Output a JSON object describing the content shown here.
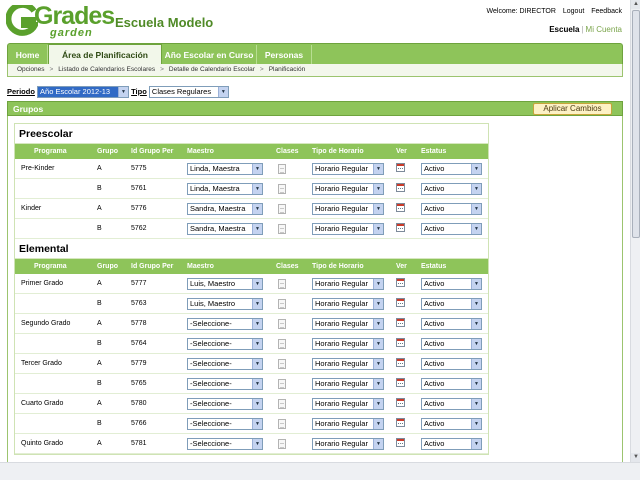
{
  "logo": {
    "line1": "Grades",
    "line2": "garden"
  },
  "school_name": "Escuela Modelo",
  "top_links": {
    "welcome": "Welcome: DIRECTOR",
    "logout": "Logout",
    "feedback": "Feedback"
  },
  "roles": {
    "active": "Escuela",
    "other": "Mi Cuenta"
  },
  "tabs": [
    {
      "label": "Home"
    },
    {
      "label": "Área de Planificación"
    },
    {
      "label": "Año Escolar en Curso"
    },
    {
      "label": "Personas"
    }
  ],
  "breadcrumb": [
    "Opciones",
    "Listado de Calendarios Escolares",
    "Detalle de Calendario Escolar",
    "Planificación"
  ],
  "filter": {
    "periodo_label": "Periodo",
    "periodo_value": "Año Escolar 2012-13",
    "tipo_label": "Tipo",
    "tipo_value": "Clases Regulares"
  },
  "groups_title": "Grupos",
  "apply_button": "Aplicar Cambios",
  "columns": [
    "Programa",
    "Grupo",
    "Id Grupo Per",
    "Maestro",
    "Clases",
    "Tipo de Horario",
    "Ver",
    "Estatus"
  ],
  "sections": [
    {
      "title": "Preescolar",
      "rows": [
        {
          "programa": "Pre-Kinder",
          "grupo": "A",
          "id": "5775",
          "maestro": "Linda, Maestra",
          "horario": "Horario Regular",
          "estatus": "Activo"
        },
        {
          "programa": "",
          "grupo": "B",
          "id": "5761",
          "maestro": "Linda, Maestra",
          "horario": "Horario Regular",
          "estatus": "Activo"
        },
        {
          "programa": "Kinder",
          "grupo": "A",
          "id": "5776",
          "maestro": "Sandra, Maestra",
          "horario": "Horario Regular",
          "estatus": "Activo"
        },
        {
          "programa": "",
          "grupo": "B",
          "id": "5762",
          "maestro": "Sandra, Maestra",
          "horario": "Horario Regular",
          "estatus": "Activo"
        }
      ]
    },
    {
      "title": "Elemental",
      "rows": [
        {
          "programa": "Primer Grado",
          "grupo": "A",
          "id": "5777",
          "maestro": "Luis, Maestro",
          "horario": "Horario Regular",
          "estatus": "Activo"
        },
        {
          "programa": "",
          "grupo": "B",
          "id": "5763",
          "maestro": "Luis, Maestro",
          "horario": "Horario Regular",
          "estatus": "Activo"
        },
        {
          "programa": "Segundo Grado",
          "grupo": "A",
          "id": "5778",
          "maestro": "-Seleccione-",
          "horario": "Horario Regular",
          "estatus": "Activo"
        },
        {
          "programa": "",
          "grupo": "B",
          "id": "5764",
          "maestro": "-Seleccione-",
          "horario": "Horario Regular",
          "estatus": "Activo"
        },
        {
          "programa": "Tercer Grado",
          "grupo": "A",
          "id": "5779",
          "maestro": "-Seleccione-",
          "horario": "Horario Regular",
          "estatus": "Activo"
        },
        {
          "programa": "",
          "grupo": "B",
          "id": "5765",
          "maestro": "-Seleccione-",
          "horario": "Horario Regular",
          "estatus": "Activo"
        },
        {
          "programa": "Cuarto Grado",
          "grupo": "A",
          "id": "5780",
          "maestro": "-Seleccione-",
          "horario": "Horario Regular",
          "estatus": "Activo"
        },
        {
          "programa": "",
          "grupo": "B",
          "id": "5766",
          "maestro": "-Seleccione-",
          "horario": "Horario Regular",
          "estatus": "Activo"
        },
        {
          "programa": "Quinto Grado",
          "grupo": "A",
          "id": "5781",
          "maestro": "-Seleccione-",
          "horario": "Horario Regular",
          "estatus": "Activo"
        }
      ]
    }
  ],
  "colors": {
    "brand_green": "#8ec45a",
    "title_green": "#4f8a26",
    "apply_bg": "#fdf1c5"
  }
}
